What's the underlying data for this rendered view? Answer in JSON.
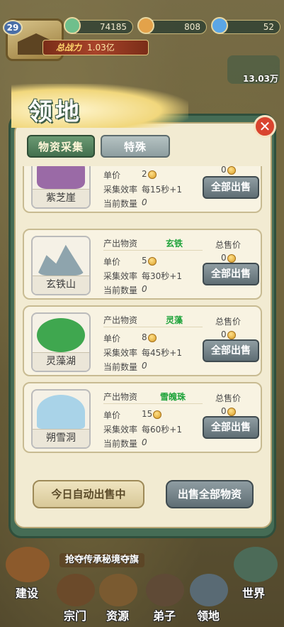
{
  "topbar": {
    "level": "29",
    "resources": [
      {
        "value": "74185",
        "icon": "jade-icon",
        "color": "#6fbf8c"
      },
      {
        "value": "808",
        "icon": "spirit-orb-icon",
        "color": "#e3a24a"
      },
      {
        "value": "52",
        "icon": "diamond-icon",
        "color": "#5ba6e6"
      }
    ],
    "power_label": "总战力",
    "power_value": "1.03亿",
    "right_value": "13.03万"
  },
  "window": {
    "title": "领地",
    "tabs": [
      {
        "label": "物资采集",
        "active": true
      },
      {
        "label": "特殊",
        "active": false
      }
    ]
  },
  "labels": {
    "output_material": "产出物资",
    "total_price": "总售价",
    "unit_price": "单价",
    "efficiency": "采集效率",
    "current_count": "当前数量",
    "sell_all": "全部出售"
  },
  "territories": [
    {
      "name": "紫芝崖",
      "material": "",
      "unit_price": "2",
      "efficiency": "每15秒+1",
      "count": "0",
      "total": "0",
      "art_color": "#9a6aa6"
    },
    {
      "name": "玄铁山",
      "material": "玄铁",
      "unit_price": "5",
      "efficiency": "每30秒+1",
      "count": "0",
      "total": "0",
      "art_color": "#8ea4ad"
    },
    {
      "name": "灵藻湖",
      "material": "灵藻",
      "unit_price": "8",
      "efficiency": "每45秒+1",
      "count": "0",
      "total": "0",
      "art_color": "#3fa74f"
    },
    {
      "name": "朔雪洞",
      "material": "雪魄珠",
      "unit_price": "15",
      "efficiency": "每60秒+1",
      "count": "0",
      "total": "0",
      "art_color": "#a9d3e8"
    }
  ],
  "actions": {
    "auto_sell": "今日自动出售中",
    "sell_everything": "出售全部物资"
  },
  "banner": "抢夺传承秘境夺旗",
  "bottom_nav": [
    "建设",
    "宗门",
    "资源",
    "弟子",
    "领地",
    "世界"
  ],
  "colors": {
    "accent_green": "#44704e",
    "material_text": "#1ea33a",
    "close_red": "#d9442f",
    "panel_bg": "#f2ebd2"
  }
}
